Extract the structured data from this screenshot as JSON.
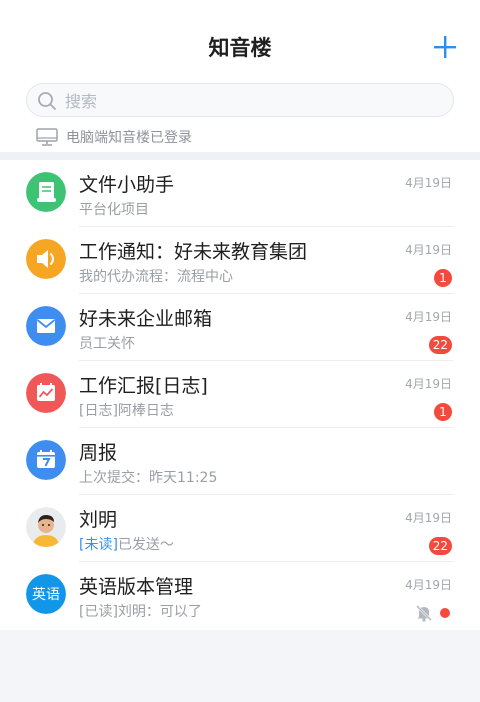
{
  "header": {
    "title": "知音楼",
    "add_icon": "plus-icon"
  },
  "search": {
    "placeholder": "搜索",
    "icon": "search-icon"
  },
  "pc_login": {
    "text": "电脑端知音楼已登录",
    "icon": "monitor-icon"
  },
  "colors": {
    "accent": "#2f8ee8",
    "badge": "#f24a3d",
    "green": "#3ec374",
    "orange": "#f6a623",
    "blue": "#3d8ef0",
    "red": "#f05757"
  },
  "conversations": [
    {
      "name": "文件小助手",
      "sub": "平台化项目",
      "date": "4月19日",
      "badge": "",
      "icon": "document-icon"
    },
    {
      "name": "工作通知：好未来教育集团",
      "sub": "我的代办流程：流程中心",
      "date": "4月19日",
      "badge": "1",
      "icon": "speaker-icon"
    },
    {
      "name": "好未来企业邮箱",
      "sub": "员工关怀",
      "date": "4月19日",
      "badge": "22",
      "icon": "mail-icon"
    },
    {
      "name": "工作汇报[日志]",
      "sub": "[日志]阿棒日志",
      "date": "4月19日",
      "badge": "1",
      "icon": "report-chart-icon"
    },
    {
      "name": "周报",
      "sub": "上次提交：昨天11:25",
      "date": "",
      "badge": "",
      "icon": "calendar-icon"
    },
    {
      "name": "刘明",
      "sub_tag": "[未读]",
      "sub": "已发送～",
      "date": "4月19日",
      "badge": "22",
      "icon": "user-avatar"
    },
    {
      "name": "英语版本管理",
      "avatar_text": "英语",
      "sub": "[已读]刘明：可以了",
      "date": "4月19日",
      "badge": "",
      "muted": true,
      "icon": "mute-bell-icon"
    }
  ]
}
